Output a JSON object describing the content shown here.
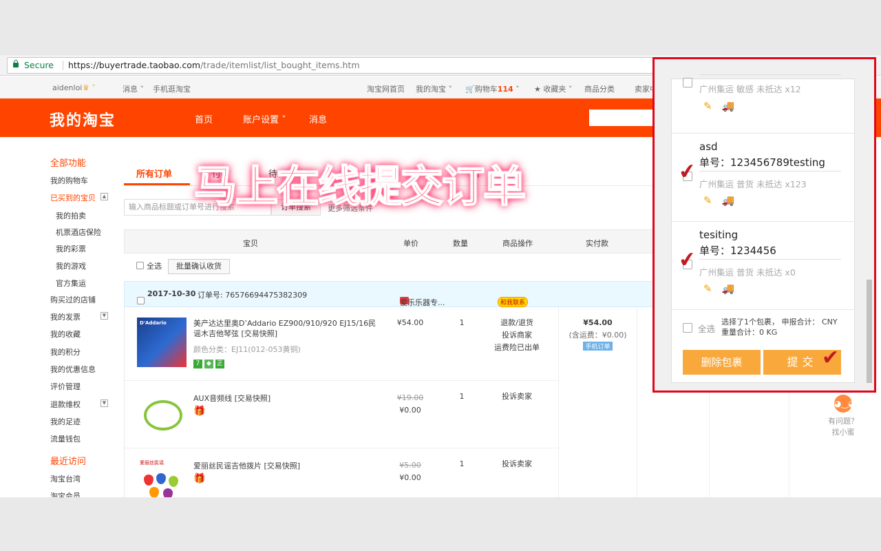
{
  "browser": {
    "secure_label": "Secure",
    "url_domain": "https://buyertrade.taobao.com",
    "url_path": "/trade/itemlist/list_bought_items.htm"
  },
  "sitenav": {
    "user": "aidenloi",
    "messages": "消息",
    "mobile": "手机逛淘宝",
    "home": "淘宝网首页",
    "my_taobao": "我的淘宝",
    "cart": "购物车",
    "cart_count": "114",
    "favorites": "收藏夹",
    "categories": "商品分类",
    "seller": "卖家中"
  },
  "header": {
    "logo": "我的淘宝",
    "nav": [
      "首页",
      "账户设置",
      "消息"
    ]
  },
  "sidebar": {
    "all_features": "全部功能",
    "items": [
      "我的购物车",
      "已买到的宝贝",
      "我的拍卖",
      "机票酒店保险",
      "我的彩票",
      "我的游戏",
      "官方集运",
      "购买过的店铺",
      "我的发票",
      "我的收藏",
      "我的积分",
      "我的优惠信息",
      "评价管理",
      "退款维权",
      "我的足迹",
      "流量钱包"
    ],
    "recent": "最近访问",
    "recent_items": [
      "淘宝台湾",
      "淘宝会员"
    ]
  },
  "tabs": {
    "all": "所有订单",
    "t2": "付",
    "t3": "待",
    "t4": "货",
    "t5": "价"
  },
  "search": {
    "placeholder": "输入商品标题或订单号进行搜索",
    "button": "订单搜索",
    "more": "更多筛选条件"
  },
  "table": {
    "headers": [
      "宝贝",
      "单价",
      "数量",
      "商品操作",
      "实付款"
    ],
    "select_all": "全选",
    "batch": "批量确认收货"
  },
  "order": {
    "date": "2017-10-30",
    "number_label": "订单号: 76576694475382309",
    "shop": "爱乐乐器专...",
    "contact": "和我联系",
    "items": [
      {
        "title": "美产达达里奥D’Addario EZ900/910/920 EJ15/16民谣木吉他琴弦 [交易快照]",
        "sku": "颜色分类：EJ11(012-053黄铜)",
        "price": "¥54.00",
        "qty": "1",
        "ops": [
          "退款/退货",
          "投诉商家",
          "运费险已出单"
        ]
      },
      {
        "title": "AUX音频线 [交易快照]",
        "old_price": "¥19.00",
        "price": "¥0.00",
        "qty": "1",
        "ops": [
          "投诉卖家"
        ]
      },
      {
        "title": "爱丽丝民谣吉他拨片 [交易快照]",
        "old_price": "¥5.00",
        "price": "¥0.00",
        "qty": "1",
        "ops": [
          "投诉卖家"
        ]
      }
    ],
    "total": "¥54.00",
    "shipping": "(含运费：¥0.00)",
    "mobile_tag": "手机订单"
  },
  "overlay_text": "马上在线提交订单",
  "popup": {
    "packages": [
      {
        "name": "",
        "number": "",
        "info": "广州集运   敏感   未抵达   x12",
        "checked": false
      },
      {
        "name": "asd",
        "number": "单号：123456789testing",
        "info": "广州集运   普货   未抵达   x123",
        "checked": true
      },
      {
        "name": "tesiting",
        "number": "单号：1234456",
        "info": "广州集运   普货   未抵达   x0",
        "checked": true
      }
    ],
    "select_all": "全选",
    "summary_line1": "选择了1个包裹，  申报合计： CNY",
    "summary_line2": "重量合计：0 KG",
    "delete_button": "删除包裹",
    "submit_button": "提交"
  },
  "helper": {
    "line1": "有问题？",
    "line2": "找小蜜"
  }
}
